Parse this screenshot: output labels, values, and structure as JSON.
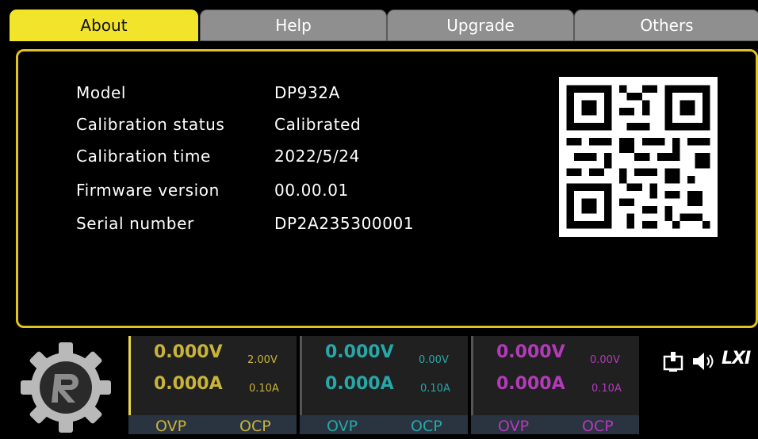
{
  "tabs": [
    {
      "label": "About",
      "active": true
    },
    {
      "label": "Help",
      "active": false
    },
    {
      "label": "Upgrade",
      "active": false
    },
    {
      "label": "Others",
      "active": false
    }
  ],
  "about": {
    "rows": [
      {
        "label": "Model",
        "value": "DP932A"
      },
      {
        "label": "Calibration status",
        "value": "Calibrated"
      },
      {
        "label": "Calibration time",
        "value": "2022/5/24"
      },
      {
        "label": "Firmware version",
        "value": "00.00.01"
      },
      {
        "label": "Serial number",
        "value": "DP2A235300001"
      }
    ],
    "qr_icon": "qr-code-icon"
  },
  "channels": [
    {
      "voltage": "0.000V",
      "current": "0.000A",
      "v_set": "2.00V",
      "a_set": "0.10A",
      "ovp": "OVP",
      "ocp": "OCP",
      "color": "#c9b43a"
    },
    {
      "voltage": "0.000V",
      "current": "0.000A",
      "v_set": "0.00V",
      "a_set": "0.10A",
      "ovp": "OVP",
      "ocp": "OCP",
      "color": "#28a7a8"
    },
    {
      "voltage": "0.000V",
      "current": "0.000A",
      "v_set": "0.00V",
      "a_set": "0.10A",
      "ovp": "OVP",
      "ocp": "OCP",
      "color": "#b33ab9"
    }
  ],
  "status_icons": {
    "logo": "gear-logo-icon",
    "connect": "connection-icon",
    "sound": "speaker-icon",
    "lxi": "LXI"
  },
  "colors": {
    "accent": "#f2e32b",
    "border": "#e2c21e"
  }
}
